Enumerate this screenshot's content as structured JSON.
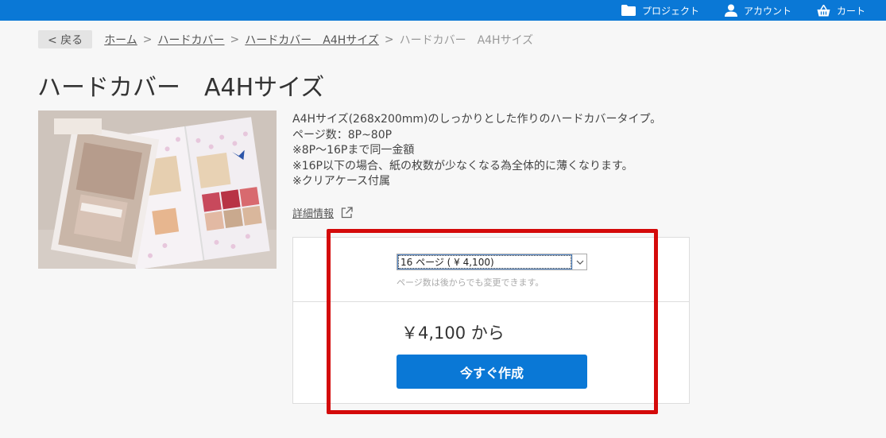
{
  "header": {
    "nav": [
      {
        "label": "プロジェクト",
        "icon": "folder-icon"
      },
      {
        "label": "アカウント",
        "icon": "user-icon"
      },
      {
        "label": "カート",
        "icon": "basket-icon"
      }
    ],
    "bg_color": "#0a78d6"
  },
  "breadcrumb": {
    "back_label": "< 戻る",
    "items": [
      "ホーム",
      "ハードカバー",
      "ハードカバー　A4Hサイズ"
    ],
    "separator": ">",
    "current": "ハードカバー　A4Hサイズ"
  },
  "product": {
    "title": "ハードカバー　A4Hサイズ",
    "image_icon": "photobook-photo",
    "description": [
      "A4Hサイズ(268x200mm)のしっかりとした作りのハードカバータイプ。",
      "ページ数：8P~80P",
      "※8P～16Pまで同一金額",
      "※16P以下の場合、紙の枚数が少なくなる為全体的に薄くなります。",
      "※クリアケース付属"
    ],
    "detail_link": "詳細情報",
    "detail_icon": "external-link-icon"
  },
  "order": {
    "page_select_value": "16 ページ ( ¥ 4,100)",
    "page_select_hint": "ページ数は後からでも変更できます。",
    "price": "￥4,100 から",
    "create_button": "今すぐ作成",
    "button_color": "#0a78d6",
    "highlight_color": "#d40a0a"
  }
}
